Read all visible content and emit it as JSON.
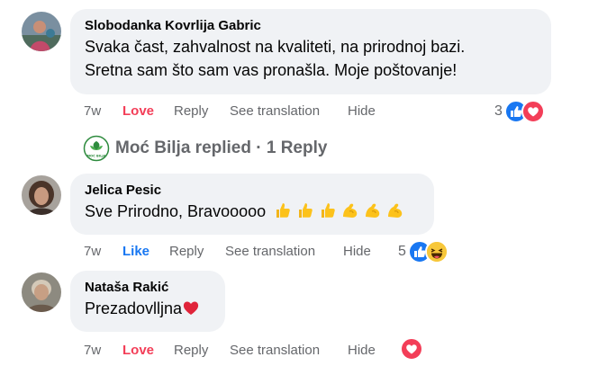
{
  "comments": [
    {
      "author": "Slobodanka Kovrlija Gabric",
      "lines": [
        "Svaka čast, zahvalnost na kvaliteti, na prirodnoj bazi.",
        "Sretna sam što sam vas pronašla. Moje poštovanje!"
      ],
      "time": "7w",
      "reaction_label": "Love",
      "reply_label": "Reply",
      "translate_label": "See translation",
      "hide_label": "Hide",
      "reaction_count": "3",
      "reactions": [
        "like-icon",
        "love-icon"
      ]
    },
    {
      "author": "Jelica Pesic",
      "text": "Sve Prirodno, Bravooooo",
      "emojis": [
        "thumbs-up",
        "thumbs-up",
        "thumbs-up",
        "flexed-biceps",
        "flexed-biceps",
        "flexed-biceps"
      ],
      "time": "7w",
      "reaction_label": "Like",
      "reply_label": "Reply",
      "translate_label": "See translation",
      "hide_label": "Hide",
      "reaction_count": "5",
      "reactions": [
        "like-icon",
        "laughing-icon"
      ]
    },
    {
      "author": "Nataša Rakić",
      "text": "Prezadovlljna",
      "emojis": [
        "red-heart"
      ],
      "time": "7w",
      "reaction_label": "Love",
      "reply_label": "Reply",
      "translate_label": "See translation",
      "hide_label": "Hide",
      "reactions": [
        "love-icon"
      ]
    }
  ],
  "reply_thread": {
    "text": "Moć Bilja replied · 1 Reply",
    "page_logo_text": "MOĆ BILJA"
  },
  "colors": {
    "bubble": "#f0f2f5",
    "meta": "#65676b",
    "love": "#f33e58",
    "like": "#1877f2"
  }
}
